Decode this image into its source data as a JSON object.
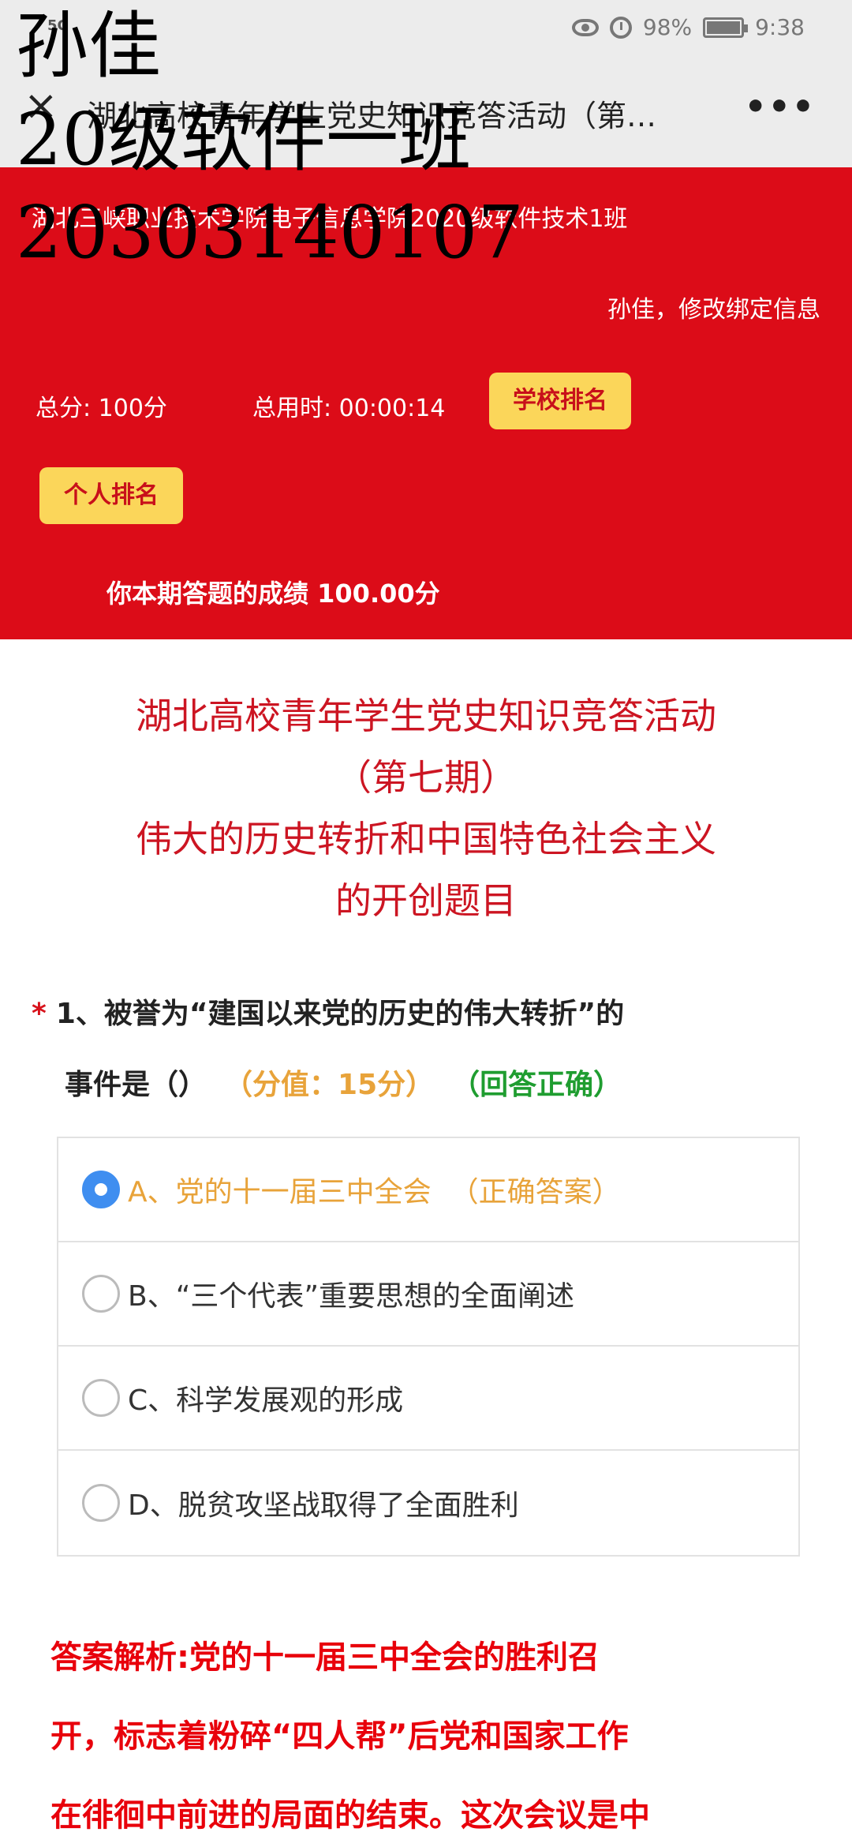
{
  "status_bar": {
    "signal": "5G",
    "battery": "98%",
    "time": "9:38"
  },
  "title_bar": {
    "close_label": "×",
    "title": "湖北高校青年学生党史知识竞答活动（第…",
    "more_label": "•••"
  },
  "watermark": {
    "line1": "孙佳",
    "line2": "20级软件一班",
    "line3": "20303140107"
  },
  "header": {
    "school": "湖北三峡职业技术学院电子信息学院2020级软件技术1班",
    "user": "孙佳，修改绑定信息",
    "total_score": "总分: 100分",
    "total_time": "总用时: 00:00:14",
    "school_rank": "学校排名",
    "personal_rank": "个人排名",
    "result": "你本期答题的成绩 100.00分"
  },
  "quiz": {
    "title_line1": "湖北高校青年学生党史知识竞答活动",
    "title_line2": "（第七期）",
    "title_line3": "伟大的历史转折和中国特色社会主义",
    "title_line4": "的开创题目"
  },
  "question": {
    "star": "*",
    "text_part1": "1、被誉为“建国以来党的历史的伟大转折”的",
    "text_part2": "事件是（）",
    "score": "（分值：15分）",
    "result": "（回答正确）",
    "options": [
      {
        "label": "A、党的十一届三中全会",
        "tag": "（正确答案）"
      },
      {
        "label": "B、“三个代表”重要思想的全面阐述"
      },
      {
        "label": "C、科学发展观的形成"
      },
      {
        "label": "D、脱贫攻坚战取得了全面胜利"
      }
    ]
  },
  "analysis": {
    "line1": "答案解析:党的十一届三中全会的胜利召",
    "line2": "开，标志着粉碎“四人帮”后党和国家工作",
    "line3": "在徘徊中前进的局面的结束。这次会议是中"
  }
}
